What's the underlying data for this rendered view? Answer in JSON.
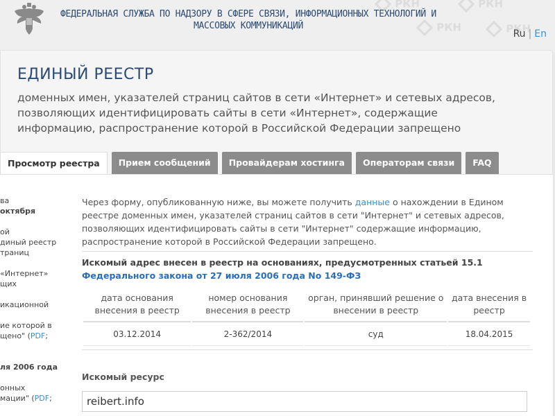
{
  "header": {
    "agency_line1": "ФЕДЕРАЛЬНАЯ СЛУЖБА ПО НАДЗОРУ В СФЕРЕ СВЯЗИ, ИНФОРМАЦИОННЫХ ТЕХНОЛОГИЙ И",
    "agency_line2": "МАССОВЫХ КОММУНИКАЦИЙ",
    "watermark": "РКН",
    "lang_ru": "Ru",
    "lang_sep": "|",
    "lang_en": "En"
  },
  "registry": {
    "title": "ЕДИНЫЙ РЕЕСТР",
    "subtitle": "доменных имен, указателей страниц сайтов в сети «Интернет» и сетевых адресов, позволяющих идентифицировать сайты в сети «Интернет», содержащие информацию, распространение которой в Российской Федерации запрещено"
  },
  "tabs": [
    {
      "label": "Просмотр реестра"
    },
    {
      "label": "Прием сообщений"
    },
    {
      "label": "Провайдерам хостинга"
    },
    {
      "label": "Операторам связи"
    },
    {
      "label": "FAQ"
    }
  ],
  "sidebar": {
    "l1": "ва",
    "l2": "октября",
    "l3": "ой",
    "l4": "диный реестр",
    "l5": "траниц",
    "l6": "«Интернет»",
    "l7": "щих",
    "l8": "икационной",
    "l9": "ие которой в",
    "l10": "щено\" (",
    "l10_link": "PDF",
    "l10_end": ";",
    "l11": "ля 2006 года",
    "l12": "онных",
    "l13": "мации\" (",
    "l13_link": "PDF",
    "l13_end": ";"
  },
  "intro": {
    "before_link": "Через форму, опубликованную ниже, вы можете получить ",
    "link": "данные",
    "after_link": " о нахождении в Едином реестре доменных имен, указателей страниц сайтов в сети \"Интернет\" и сетевых адресов, позволяющих идентифицировать сайты в сети \"Интернет\" содержащие информацию, распространение которой в Российской Федерации запрещено."
  },
  "found": {
    "text": "Искомый адрес внесен в реестр на основаниях, предусмотренных статьей 15.1 ",
    "law_link": "Федерального закона от 27 июля 2006 года No 149-ФЗ"
  },
  "table": {
    "headers": [
      "дата основания внесения в реестр",
      "номер основания внесения в реестр",
      "орган, принявший решение о внесении в реестр",
      "дата внесения в реестр"
    ],
    "rows": [
      [
        "03.12.2014",
        "2-362/2014",
        "суд",
        "18.04.2015"
      ]
    ]
  },
  "resource": {
    "label": "Искомый ресурс",
    "value": "reibert.info"
  },
  "colors": {
    "brand_blue": "#2b4a74",
    "link": "#3a8fd0",
    "tab_inactive": "#8c8c8c"
  }
}
